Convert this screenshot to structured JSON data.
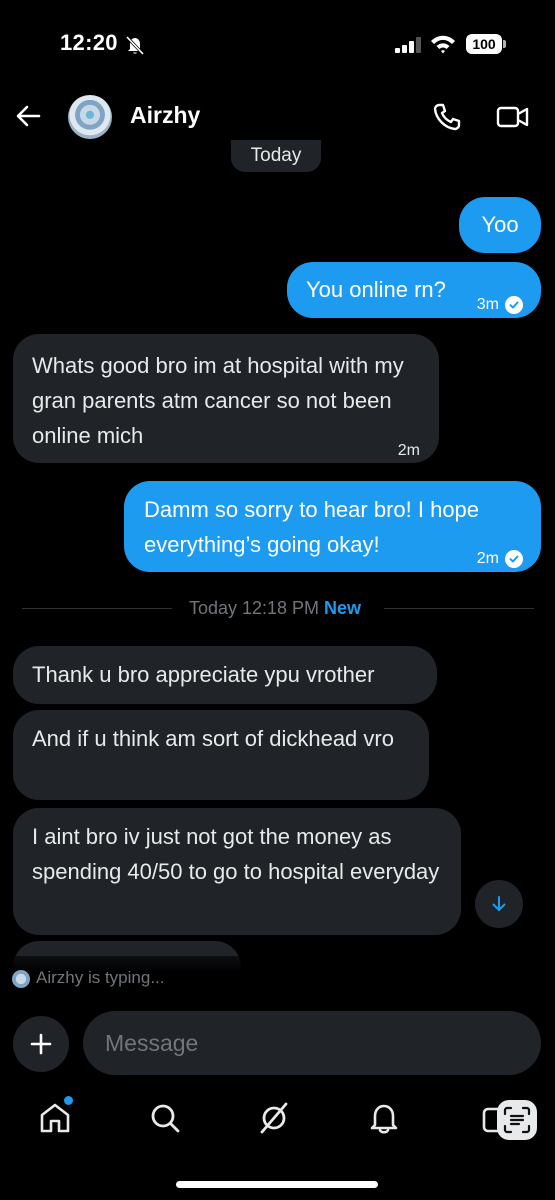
{
  "status_bar": {
    "time": "12:20",
    "battery": "100"
  },
  "header": {
    "contact_name": "Airzhy"
  },
  "conversation": {
    "top_date": "Today",
    "messages": [
      {
        "direction": "outgoing",
        "text": "Yoo",
        "time": ""
      },
      {
        "direction": "outgoing",
        "text": "You online rn?",
        "time": "3m"
      },
      {
        "direction": "incoming",
        "text": "Whats good bro im at hospital with my gran parents atm cancer so not been online mich",
        "time": "2m"
      },
      {
        "direction": "outgoing",
        "text": "Damm so sorry to hear bro! I hope everything’s going okay!",
        "time": "2m"
      },
      {
        "direction": "incoming",
        "text": "Thank u bro appreciate ypu vrother",
        "time": ""
      },
      {
        "direction": "incoming",
        "text": "And if u think am sort of dickhead vro",
        "time": ""
      },
      {
        "direction": "incoming",
        "text": "I aint bro iv just not got the money as spending 40/50 to go to hospital everyday",
        "time": ""
      }
    ],
    "divider": {
      "text": "Today 12:18 PM",
      "badge": "New"
    },
    "typing_indicator": "Airzhy is typing..."
  },
  "composer": {
    "placeholder": "Message"
  },
  "colors": {
    "accent": "#1d9bf0",
    "incoming_bubble": "#202327",
    "background": "#000000"
  },
  "icons": {
    "header": [
      "back-arrow-icon",
      "phone-icon",
      "video-icon"
    ],
    "nav": [
      "home-icon",
      "search-icon",
      "grok-icon",
      "bell-icon",
      "mail-icon"
    ]
  }
}
